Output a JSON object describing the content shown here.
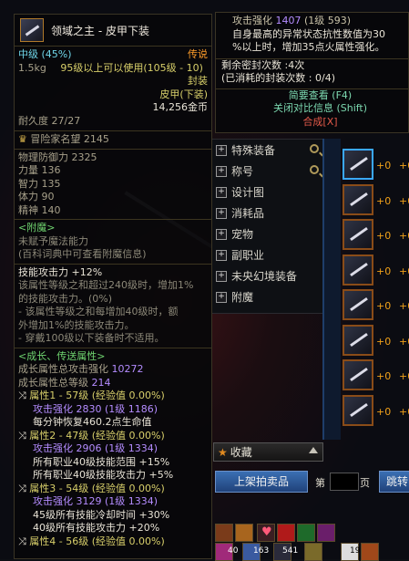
{
  "item": {
    "name": "领域之主 - 皮甲下装",
    "grade": "中级",
    "grade_pct": "(45%)",
    "rarity": "传说",
    "weight": "1.5kg",
    "level_req": "95级以上可以使用(105级 - 10)",
    "sealed": "封装",
    "type": "皮甲(下装)",
    "price": "14,256金币",
    "durability": "耐久度  27/27",
    "adventure": "冒险家名望 2145",
    "stats": [
      {
        "label": "物理防御力 2325"
      },
      {
        "label": "力量 136"
      },
      {
        "label": "智力 135"
      },
      {
        "label": "体力 90"
      },
      {
        "label": "精神 140"
      }
    ],
    "enchant_title": "<附魔>",
    "enchant_line1": "未赋予魔法能力",
    "enchant_line2": "(百科词典中可查看附魔信息)",
    "skill_atk": "技能攻击力 +12%",
    "skill_lines": [
      "该属性等级之和超过240级时，增加1%",
      "的技能攻击力。(0%)",
      "- 该属性等级之和每增加40级时，额",
      "外增加1%的技能攻击力。",
      "- 穿戴100级以下装备时不适用。"
    ],
    "growth_title": "<成长、传送属性>",
    "growth_total_atk_label": "成长属性总攻击强化",
    "growth_total_atk": "10272",
    "growth_total_lv_label": "成长属性总等级",
    "growth_total_lv": "214",
    "attrs": [
      {
        "title": "属性1 - 57级 (经验值 0.00%)",
        "atk": "攻击强化  2830 (1级 1186)",
        "effects": [
          "每分钟恢复460.2点生命值"
        ]
      },
      {
        "title": "属性2 - 47级 (经验值 0.00%)",
        "atk": "攻击强化  2906 (1级 1334)",
        "effects": [
          "所有职业40级技能范围 +15%",
          "所有职业40级技能攻击力 +5%"
        ]
      },
      {
        "title": "属性3 - 54级 (经验值 0.00%)",
        "atk": "攻击强化  3129 (1级 1334)",
        "effects": [
          "45级所有技能冷却时间 +30%",
          "40级所有技能攻击力 +20%"
        ]
      },
      {
        "title": "属性4 - 56级 (经验值 0.00%)",
        "atk": "",
        "effects": []
      }
    ]
  },
  "side_tip": {
    "atk_line": "攻击强化",
    "atk_val": "1407",
    "atk_sub": "(1级 593)",
    "line1": "自身最高的异常状态抗性数值为30",
    "line2": "%以上时，增加35点火属性强化。",
    "seal_remain": "剩余密封次数 :4次",
    "seal_used": "(已消耗的封装次数 : 0/4)",
    "brief": "简要查看 (F4)",
    "compare": "关闭对比信息 (Shift)",
    "compose": "合成[X]"
  },
  "categories": [
    {
      "label": "特殊装备",
      "mag": true
    },
    {
      "label": "称号",
      "mag": true
    },
    {
      "label": "设计图",
      "mag": false
    },
    {
      "label": "消耗品",
      "mag": false
    },
    {
      "label": "宠物",
      "mag": false
    },
    {
      "label": "副职业",
      "mag": false
    },
    {
      "label": "未央幻境装备",
      "mag": false
    },
    {
      "label": "附魔",
      "mag": false
    }
  ],
  "collect_label": "收藏",
  "upload_btn": "上架拍卖品",
  "page_prefix": "第",
  "page_suffix": "页",
  "jump_btn": "跳转",
  "slot_plus": "+0",
  "hotbar": {
    "n1": "40",
    "n2": "163",
    "n3": "541",
    "n4": "19"
  },
  "colors": {
    "accent_gold": "#e6a22c",
    "growth_title": "#6fd36f",
    "select_border": "#3aa8ff"
  }
}
